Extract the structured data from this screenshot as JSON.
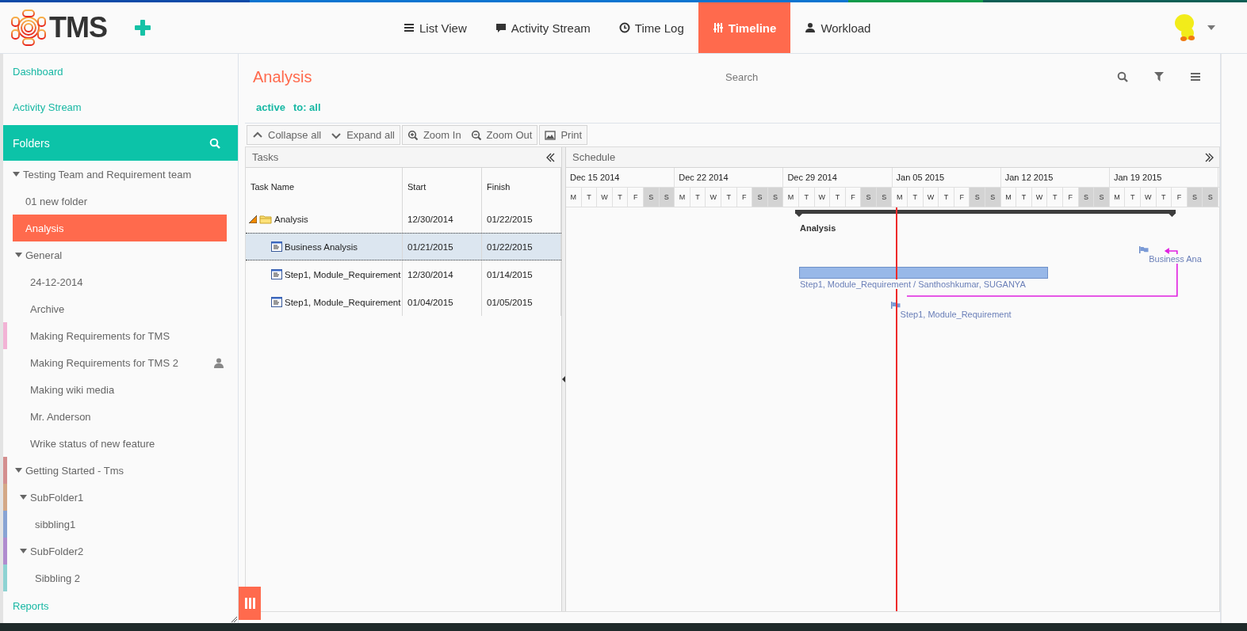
{
  "logo": {
    "text": "TMS"
  },
  "nav": [
    {
      "label": "List View",
      "selected": false
    },
    {
      "label": "Activity Stream",
      "selected": false
    },
    {
      "label": "Time Log",
      "selected": false
    },
    {
      "label": "Timeline",
      "selected": true
    },
    {
      "label": "Workload",
      "selected": false
    }
  ],
  "sidebar": {
    "links_top": [
      {
        "label": "Dashboard"
      },
      {
        "label": "Activity Stream"
      }
    ],
    "folders_header": {
      "label": "Folders"
    },
    "tree": [
      {
        "label": "Testing Team and Requirement team",
        "expanded": true,
        "selected": false,
        "shared": false,
        "children": [
          {
            "label": "01 new folder",
            "selected": false,
            "shared": false
          },
          {
            "label": "Analysis",
            "selected": true,
            "shared": false
          },
          {
            "label": "General",
            "expanded": true,
            "selected": false,
            "shared": false,
            "children": [
              {
                "label": "24-12-2014",
                "selected": false,
                "shared": false
              },
              {
                "label": "Archive",
                "selected": false,
                "shared": false
              },
              {
                "label": "Making Requirements for TMS",
                "selected": false,
                "shared": false,
                "color": "#f2b3d6"
              },
              {
                "label": "Making Requirements for TMS 2",
                "selected": false,
                "shared": true
              },
              {
                "label": "Making wiki media",
                "selected": false,
                "shared": false
              },
              {
                "label": "Mr. Anderson",
                "selected": false,
                "shared": false
              },
              {
                "label": "Wrike status of new feature",
                "selected": false,
                "shared": false
              }
            ]
          },
          {
            "label": "Getting Started - Tms",
            "expanded": true,
            "selected": false,
            "shared": false,
            "color": "#d48f8f",
            "children": [
              {
                "label": "SubFolder1",
                "expanded": true,
                "selected": false,
                "shared": false,
                "color": "#d4a886",
                "children": [
                  {
                    "label": "sibbling1",
                    "selected": false,
                    "shared": false,
                    "color": "#88a4d4"
                  }
                ]
              },
              {
                "label": "SubFolder2",
                "expanded": true,
                "selected": false,
                "shared": false,
                "color": "#b08ccf",
                "children": [
                  {
                    "label": "Sibbling 2",
                    "selected": false,
                    "shared": false,
                    "color": "#8ed3d3"
                  }
                ]
              }
            ]
          }
        ]
      }
    ],
    "links_bottom": [
      {
        "label": "Reports"
      }
    ]
  },
  "main": {
    "title": "Analysis",
    "search": {
      "placeholder": "Search"
    },
    "filters": [
      {
        "label": "active"
      },
      {
        "label": "to: all"
      }
    ],
    "toolbar": [
      {
        "buttons": [
          {
            "label": "Collapse all"
          },
          {
            "label": "Expand all"
          }
        ]
      },
      {
        "buttons": [
          {
            "label": "Zoom In"
          },
          {
            "label": "Zoom Out"
          }
        ]
      },
      {
        "buttons": [
          {
            "label": "Print"
          }
        ]
      }
    ]
  },
  "tasks": {
    "title": "Tasks",
    "columns": [
      "Task Name",
      "Start",
      "Finish"
    ],
    "rows": [
      {
        "kind": "summary",
        "name": "Analysis",
        "start": "12/30/2014",
        "finish": "01/22/2015",
        "expanded": true,
        "selected": false,
        "children": [
          {
            "kind": "task",
            "name": "Business Analysis",
            "start": "01/21/2015",
            "finish": "01/22/2015",
            "selected": true
          },
          {
            "kind": "task",
            "name": "Step1, Module_Requirement",
            "start": "12/30/2014",
            "finish": "01/14/2015",
            "selected": false
          },
          {
            "kind": "task",
            "name": "Step1, Module_Requirement",
            "start": "01/04/2015",
            "finish": "01/05/2015",
            "selected": false
          }
        ]
      }
    ]
  },
  "schedule": {
    "title": "Schedule",
    "weeks": [
      {
        "label": "Dec 15 2014",
        "days": [
          {
            "letter": "M",
            "weekend": false
          },
          {
            "letter": "T",
            "weekend": false
          },
          {
            "letter": "W",
            "weekend": false
          },
          {
            "letter": "T",
            "weekend": false
          },
          {
            "letter": "F",
            "weekend": false
          },
          {
            "letter": "S",
            "weekend": true
          },
          {
            "letter": "S",
            "weekend": true
          }
        ]
      },
      {
        "label": "Dec 22 2014",
        "days": [
          {
            "letter": "M",
            "weekend": false
          },
          {
            "letter": "T",
            "weekend": false
          },
          {
            "letter": "W",
            "weekend": false
          },
          {
            "letter": "T",
            "weekend": false
          },
          {
            "letter": "F",
            "weekend": false
          },
          {
            "letter": "S",
            "weekend": true
          },
          {
            "letter": "S",
            "weekend": true
          }
        ]
      },
      {
        "label": "Dec 29 2014",
        "days": [
          {
            "letter": "M",
            "weekend": false
          },
          {
            "letter": "T",
            "weekend": false
          },
          {
            "letter": "W",
            "weekend": false
          },
          {
            "letter": "T",
            "weekend": false
          },
          {
            "letter": "F",
            "weekend": false
          },
          {
            "letter": "S",
            "weekend": true
          },
          {
            "letter": "S",
            "weekend": true
          }
        ]
      },
      {
        "label": "Jan 05 2015",
        "days": [
          {
            "letter": "M",
            "weekend": false
          },
          {
            "letter": "T",
            "weekend": false
          },
          {
            "letter": "W",
            "weekend": false
          },
          {
            "letter": "T",
            "weekend": false
          },
          {
            "letter": "F",
            "weekend": false
          },
          {
            "letter": "S",
            "weekend": true
          },
          {
            "letter": "S",
            "weekend": true
          }
        ]
      },
      {
        "label": "Jan 12 2015",
        "days": [
          {
            "letter": "M",
            "weekend": false
          },
          {
            "letter": "T",
            "weekend": false
          },
          {
            "letter": "W",
            "weekend": false
          },
          {
            "letter": "T",
            "weekend": false
          },
          {
            "letter": "F",
            "weekend": false
          },
          {
            "letter": "S",
            "weekend": true
          },
          {
            "letter": "S",
            "weekend": true
          }
        ]
      },
      {
        "label": "Jan 19 2015",
        "days": [
          {
            "letter": "M",
            "weekend": false
          },
          {
            "letter": "T",
            "weekend": false
          },
          {
            "letter": "W",
            "weekend": false
          },
          {
            "letter": "T",
            "weekend": false
          },
          {
            "letter": "F",
            "weekend": false
          },
          {
            "letter": "S",
            "weekend": true
          },
          {
            "letter": "S",
            "weekend": true
          }
        ]
      }
    ],
    "items": [
      {
        "kind": "summary",
        "label": "Analysis"
      },
      {
        "kind": "milestone",
        "label": "Business Ana"
      },
      {
        "kind": "task",
        "label": "Step1, Module_Requirement / Santhoshkumar, SUGANYA"
      },
      {
        "kind": "milestone",
        "label": "Step1, Module_Requirement"
      }
    ]
  }
}
